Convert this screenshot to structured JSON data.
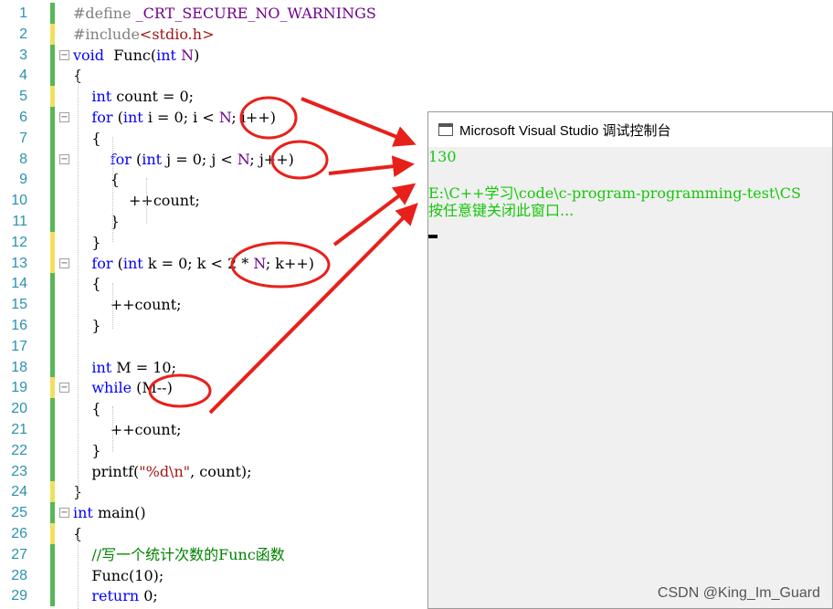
{
  "editor": {
    "lines": [
      {
        "n": "1",
        "parts": [
          [
            "pp",
            "#define "
          ],
          [
            "mac",
            "_CRT_SECURE_NO_WARNINGS"
          ]
        ]
      },
      {
        "n": "2",
        "parts": [
          [
            "pp",
            "#include"
          ],
          [
            "str",
            "<stdio.h>"
          ]
        ]
      },
      {
        "n": "3",
        "parts": [
          [
            "kw",
            "void"
          ],
          [
            "",
            "  Func("
          ],
          [
            "kw",
            "int"
          ],
          [
            "mac",
            " N"
          ],
          [
            "",
            ")"
          ]
        ]
      },
      {
        "n": "4",
        "parts": [
          [
            "",
            "{"
          ]
        ]
      },
      {
        "n": "5",
        "parts": [
          [
            "",
            "    "
          ],
          [
            "kw",
            "int"
          ],
          [
            "",
            " count = 0;"
          ]
        ]
      },
      {
        "n": "6",
        "parts": [
          [
            "",
            "    "
          ],
          [
            "kw",
            "for"
          ],
          [
            "",
            " ("
          ],
          [
            "kw",
            "int"
          ],
          [
            "",
            " i = 0; i < "
          ],
          [
            "mac",
            "N"
          ],
          [
            "",
            "; i++)"
          ]
        ]
      },
      {
        "n": "7",
        "parts": [
          [
            "",
            "    {"
          ]
        ]
      },
      {
        "n": "8",
        "parts": [
          [
            "",
            "        "
          ],
          [
            "kw",
            "for"
          ],
          [
            "",
            " ("
          ],
          [
            "kw",
            "int"
          ],
          [
            "",
            " j = 0; j < "
          ],
          [
            "mac",
            "N"
          ],
          [
            "",
            "; j++)"
          ]
        ]
      },
      {
        "n": "9",
        "parts": [
          [
            "",
            "        {"
          ]
        ]
      },
      {
        "n": "10",
        "parts": [
          [
            "",
            "            ++count;"
          ]
        ]
      },
      {
        "n": "11",
        "parts": [
          [
            "",
            "        }"
          ]
        ]
      },
      {
        "n": "12",
        "parts": [
          [
            "",
            "    }"
          ]
        ]
      },
      {
        "n": "13",
        "parts": [
          [
            "",
            "    "
          ],
          [
            "kw",
            "for"
          ],
          [
            "",
            " ("
          ],
          [
            "kw",
            "int"
          ],
          [
            "",
            " k = 0; k < 2 * "
          ],
          [
            "mac",
            "N"
          ],
          [
            "",
            "; k++)"
          ]
        ]
      },
      {
        "n": "14",
        "parts": [
          [
            "",
            "    {"
          ]
        ]
      },
      {
        "n": "15",
        "parts": [
          [
            "",
            "        ++count;"
          ]
        ]
      },
      {
        "n": "16",
        "parts": [
          [
            "",
            "    }"
          ]
        ]
      },
      {
        "n": "17",
        "parts": []
      },
      {
        "n": "18",
        "parts": [
          [
            "",
            "    "
          ],
          [
            "kw",
            "int"
          ],
          [
            "",
            " M = 10;"
          ]
        ]
      },
      {
        "n": "19",
        "parts": [
          [
            "",
            "    "
          ],
          [
            "kw",
            "while"
          ],
          [
            "",
            " (M--)"
          ]
        ]
      },
      {
        "n": "20",
        "parts": [
          [
            "",
            "    {"
          ]
        ]
      },
      {
        "n": "21",
        "parts": [
          [
            "",
            "        ++count;"
          ]
        ]
      },
      {
        "n": "22",
        "parts": [
          [
            "",
            "    }"
          ]
        ]
      },
      {
        "n": "23",
        "parts": [
          [
            "",
            "    printf("
          ],
          [
            "str",
            "\"%d\\n\""
          ],
          [
            "",
            ", count);"
          ]
        ]
      },
      {
        "n": "24",
        "parts": [
          [
            "",
            "}"
          ]
        ]
      },
      {
        "n": "25",
        "parts": [
          [
            "kw",
            "int"
          ],
          [
            "",
            " main()"
          ]
        ]
      },
      {
        "n": "26",
        "parts": [
          [
            "",
            "{"
          ]
        ]
      },
      {
        "n": "27",
        "parts": [
          [
            "",
            "    "
          ],
          [
            "cm",
            "//写一个统计次数的Func函数"
          ]
        ]
      },
      {
        "n": "28",
        "parts": [
          [
            "",
            "    Func(10);"
          ]
        ]
      },
      {
        "n": "29",
        "parts": [
          [
            "",
            "    "
          ],
          [
            "kw",
            "return"
          ],
          [
            "",
            " 0;"
          ]
        ]
      }
    ],
    "fold_lines": [
      "3",
      "6",
      "8",
      "13",
      "19",
      "25"
    ],
    "yellow_lines": [
      "2",
      "5",
      "12",
      "13",
      "19",
      "24",
      "26"
    ]
  },
  "console": {
    "title": "Microsoft Visual Studio 调试控制台",
    "output_1": "130",
    "output_2": "E:\\C++学习\\code\\c-program-programming-test\\CS",
    "output_3": "按任意键关闭此窗口..."
  },
  "watermark": "CSDN @King_Im_Guard",
  "colors": {
    "output": "#16c60c",
    "annotation": "#e8201a",
    "keyword": "#0000ff",
    "line_number": "#2b91af"
  }
}
